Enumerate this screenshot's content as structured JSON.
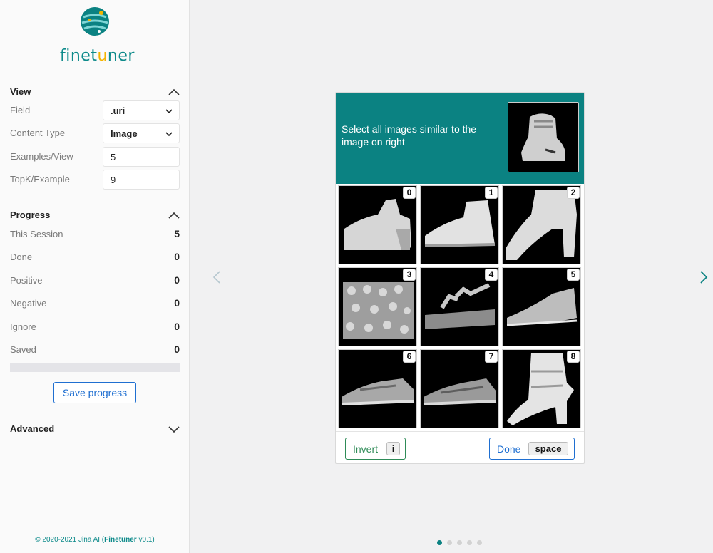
{
  "brand": {
    "name_part1": "finet",
    "name_part2": "u",
    "name_part3": "ner",
    "accent": "#0b8282",
    "highlight": "#f4b400"
  },
  "view": {
    "title": "View",
    "rows": [
      {
        "label": "Field",
        "value": ".uri"
      },
      {
        "label": "Content Type",
        "value": "Image"
      },
      {
        "label": "Examples/View",
        "value": "5"
      },
      {
        "label": "TopK/Example",
        "value": "9"
      }
    ]
  },
  "progress": {
    "title": "Progress",
    "rows": [
      {
        "label": "This Session",
        "value": "5"
      },
      {
        "label": "Done",
        "value": "0"
      },
      {
        "label": "Positive",
        "value": "0"
      },
      {
        "label": "Negative",
        "value": "0"
      },
      {
        "label": "Ignore",
        "value": "0"
      },
      {
        "label": "Saved",
        "value": "0"
      }
    ],
    "fraction": 0,
    "save_label": "Save progress"
  },
  "advanced": {
    "title": "Advanced"
  },
  "footer": {
    "prefix": "© 2020-2021 Jina AI (",
    "product": "Finetuner",
    "version": " v0.1)"
  },
  "card": {
    "prompt": "Select all images similar to the image on right",
    "tiles": [
      "0",
      "1",
      "2",
      "3",
      "4",
      "5",
      "6",
      "7",
      "8"
    ],
    "invert_label": "Invert",
    "invert_key": "i",
    "done_label": "Done",
    "done_key": "space"
  },
  "carousel": {
    "pages": 5,
    "active": 0
  }
}
